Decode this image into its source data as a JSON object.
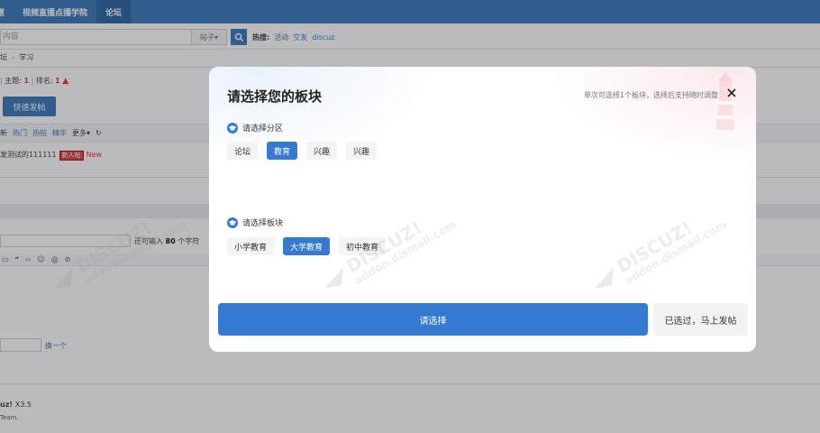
{
  "nav": {
    "items": [
      {
        "label": "道",
        "active": false
      },
      {
        "label": "视频直播点播学院",
        "active": false
      },
      {
        "label": "论坛",
        "active": true
      }
    ]
  },
  "search": {
    "input_value": "内容",
    "type_label": "帖子▾",
    "hot_label": "热搜:",
    "hot_links": [
      "活动",
      "交友",
      "discuz"
    ]
  },
  "breadcrumb": {
    "items": [
      "坛",
      "学习"
    ],
    "sep": "›"
  },
  "stats": {
    "topics_label": "主题:",
    "topics_value": "1",
    "rank_label": "排名:",
    "rank_value": "1",
    "rank_arrow": "▲"
  },
  "quick_post": {
    "label": "快速发帖"
  },
  "filters": [
    "新",
    "热门",
    "热帖",
    "精华",
    "更多▾"
  ],
  "thread": {
    "title": "发测试的111111",
    "tag": "新人帖",
    "new": "New"
  },
  "editor": {
    "char_hint_prefix": "还可输入",
    "char_count": "80",
    "char_hint_suffix": "个字符",
    "tool_icons": [
      "▭",
      "❝",
      "‹›",
      "☺",
      "@",
      "⊘"
    ]
  },
  "captcha": {
    "refresh_label": "换一个"
  },
  "footer": {
    "title": "uz!",
    "version": "X3.5",
    "sub": "Team."
  },
  "modal": {
    "title": "请选择您的板块",
    "hint": "单次可选择1个板块，选择后支持随时调整",
    "section1": {
      "label": "请选择分区",
      "chips": [
        {
          "label": "论坛",
          "selected": false
        },
        {
          "label": "教育",
          "selected": true
        },
        {
          "label": "兴趣",
          "selected": false
        },
        {
          "label": "兴趣",
          "selected": false
        }
      ]
    },
    "section2": {
      "label": "请选择板块",
      "chips": [
        {
          "label": "小学教育",
          "selected": false
        },
        {
          "label": "大学教育",
          "selected": true
        },
        {
          "label": "初中教育",
          "selected": false
        }
      ]
    },
    "primary_button": "请选择",
    "secondary_button": "已选过，马上发帖"
  },
  "colors": {
    "accent": "#3579d1",
    "nav": "#2c6fb3",
    "tag_red": "#dd3333"
  }
}
